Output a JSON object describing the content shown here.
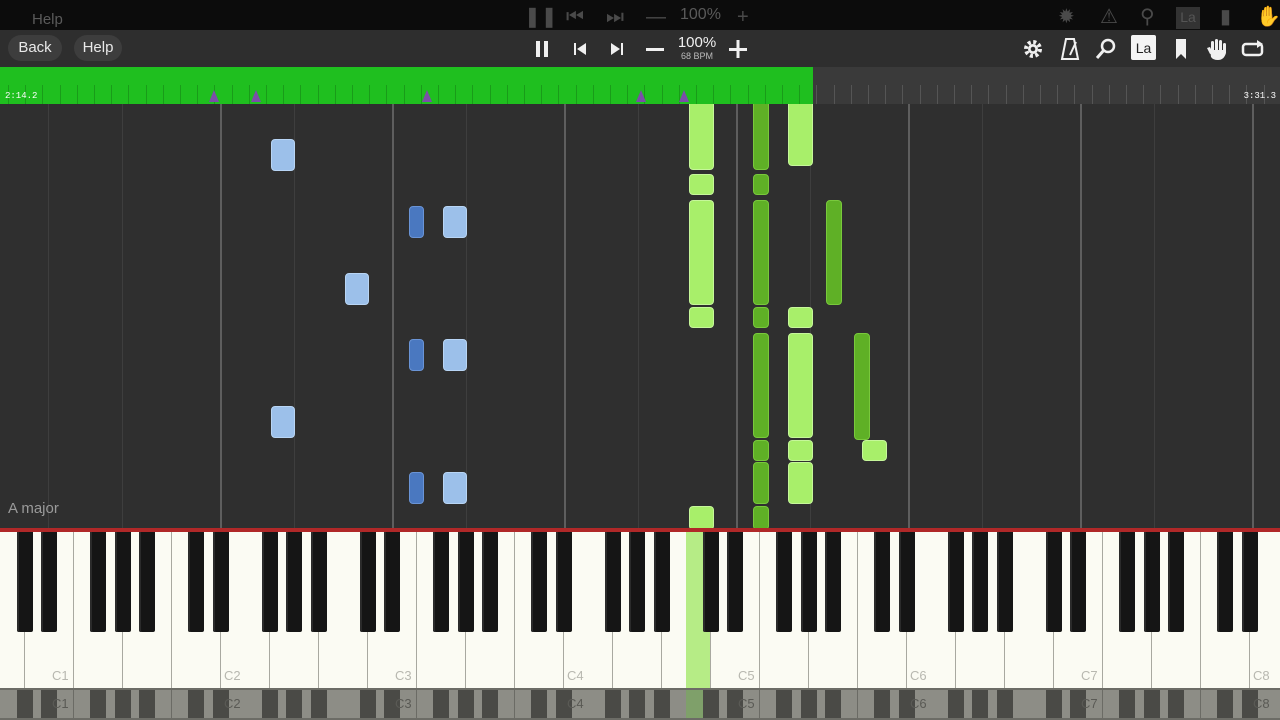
{
  "ghost": {
    "help_label": "Help",
    "zoom": "100%",
    "bpm": "68 BPM"
  },
  "toolbar": {
    "back_label": "Back",
    "help_label": "Help",
    "zoom": "100%",
    "bpm": "68 BPM",
    "icons": [
      "pause-icon",
      "skip-back-icon",
      "skip-forward-icon",
      "zoom-out-icon",
      "zoom-in-icon",
      "settings-gear-icon",
      "metronome-icon",
      "search-icon",
      "label-la-icon",
      "bookmark-icon",
      "hand-icon",
      "loop-icon"
    ],
    "label_icon_text": "La"
  },
  "timeline": {
    "current_time": "2:14.2",
    "end_time": "3:31.3",
    "progress_fraction": 0.635,
    "accent": "#1fbf1f"
  },
  "roll": {
    "key_signature": "A major"
  },
  "keyboard": {
    "labels": [
      "C1",
      "C2",
      "C3",
      "C4",
      "C5",
      "C6",
      "C7",
      "C8"
    ],
    "pressed_color": "#b6ec86",
    "note_colors": {
      "left_hand": "#9cc0ea",
      "left_hand_dark": "#4a78c0",
      "right_hand": "#a8ef6a",
      "right_hand_dark": "#5fb026"
    }
  }
}
